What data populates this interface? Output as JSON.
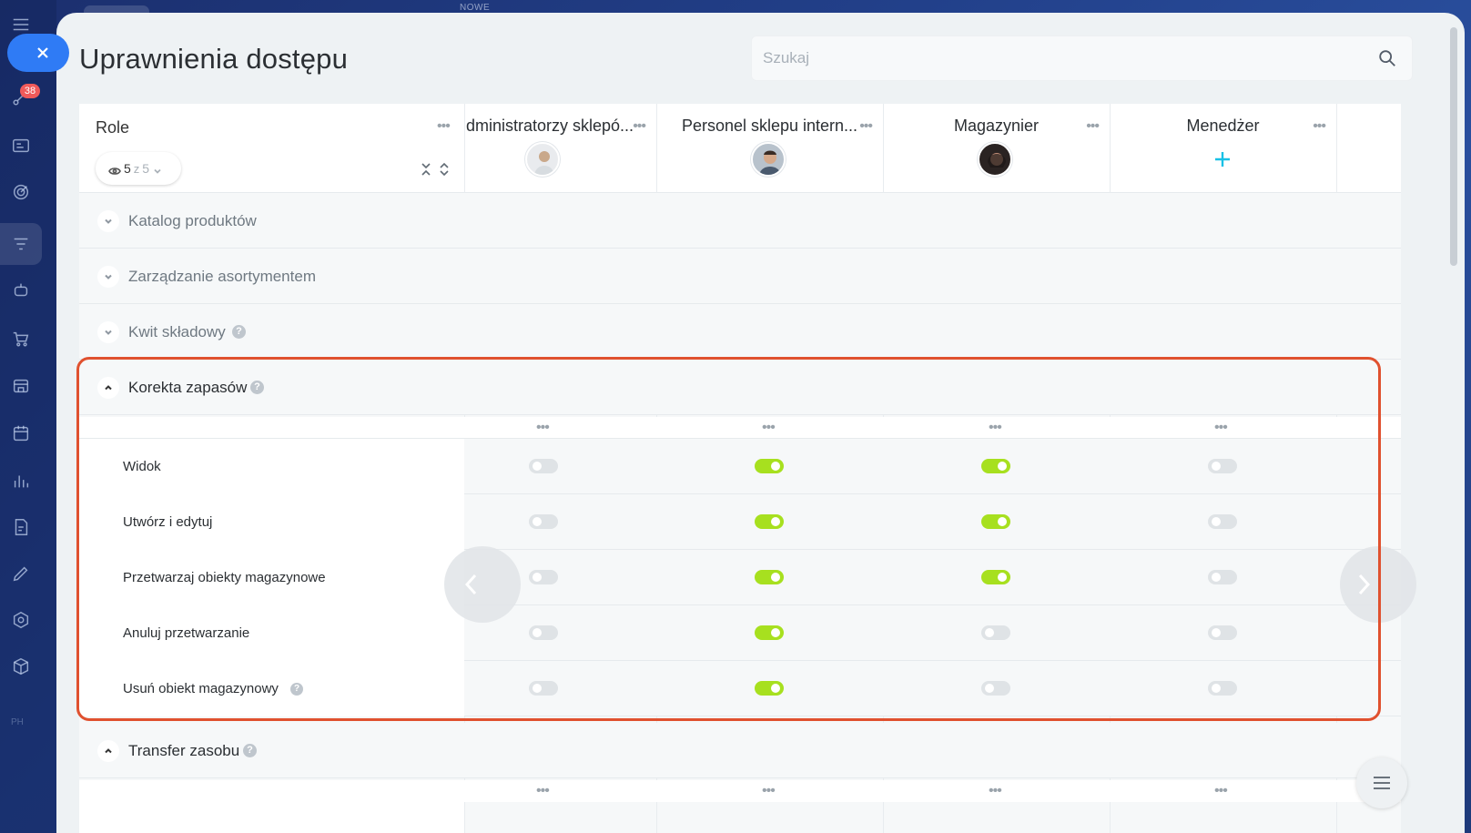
{
  "top": {
    "tag": "NOWE"
  },
  "sidebar": {
    "badge_count": "38",
    "footer_tag": "PH",
    "icons": [
      "close-icon",
      "activity-icon",
      "contacts-icon",
      "target-icon",
      "funnel-icon",
      "robot-icon",
      "cart-icon",
      "store-icon",
      "calendar-icon",
      "chart-icon",
      "document-icon",
      "pen-icon",
      "hexagon-icon",
      "box-icon"
    ]
  },
  "page": {
    "title": "Uprawnienia dostępu",
    "search_placeholder": "Szukaj"
  },
  "roles_header": {
    "title": "Role",
    "counter_current": "5",
    "counter_sep": "z",
    "counter_total": "5"
  },
  "roles": [
    {
      "name": "dministratorzy sklepó...",
      "avatar": "man-light-shirt"
    },
    {
      "name": "Personel sklepu intern...",
      "avatar": "man-dark-hair"
    },
    {
      "name": "Magazynier",
      "avatar": "woman-dark"
    },
    {
      "name": "Menedżer",
      "avatar": "add"
    }
  ],
  "sections": [
    {
      "title": "Katalog produktów",
      "expanded": false,
      "help": false
    },
    {
      "title": "Zarządzanie asortymentem",
      "expanded": false,
      "help": false
    },
    {
      "title": "Kwit składowy",
      "expanded": false,
      "help": true
    },
    {
      "title": "Korekta zapasów",
      "expanded": true,
      "help": true
    },
    {
      "title": "Transfer zasobu",
      "expanded": true,
      "help": true
    }
  ],
  "permissions": [
    {
      "label": "Widok",
      "help": false,
      "values": [
        false,
        true,
        true,
        false
      ]
    },
    {
      "label": "Utwórz i edytuj",
      "help": false,
      "values": [
        false,
        true,
        true,
        false
      ]
    },
    {
      "label": "Przetwarzaj obiekty magazynowe",
      "help": false,
      "values": [
        false,
        true,
        true,
        false
      ]
    },
    {
      "label": "Anuluj przetwarzanie",
      "help": false,
      "values": [
        false,
        true,
        false,
        false
      ]
    },
    {
      "label": "Usuń obiekt magazynowy",
      "help": true,
      "values": [
        false,
        true,
        false,
        false
      ]
    }
  ],
  "colors": {
    "toggle_on": "#a7e01f",
    "toggle_off": "#dfe3e6",
    "highlight": "#e0512f",
    "accent": "#2f7bf5",
    "add": "#19c1e6"
  }
}
